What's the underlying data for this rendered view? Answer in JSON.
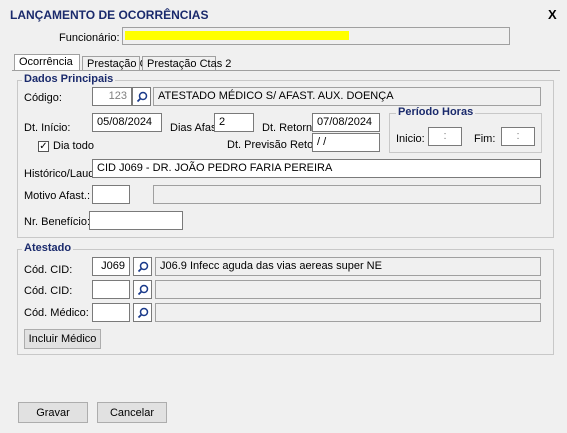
{
  "window": {
    "title": "LANÇAMENTO DE OCORRÊNCIAS",
    "close": "X"
  },
  "header": {
    "funcionario_label": "Funcionário:",
    "funcionario_value": ""
  },
  "tabs": [
    {
      "label": "Ocorrência"
    },
    {
      "label": "Prestação Ctas"
    },
    {
      "label": "Prestação Ctas 2"
    }
  ],
  "dados": {
    "group_label": "Dados Principais",
    "codigo_label": "Código:",
    "codigo_value": "123",
    "codigo_desc": "ATESTADO MÉDICO S/ AFAST. AUX. DOENÇA",
    "dt_inicio_label": "Dt. Início:",
    "dt_inicio_value": "05/08/2024",
    "dias_afast_label": "Dias Afast.",
    "dias_afast_value": "2",
    "dt_retorno_label": "Dt. Retorno:",
    "dt_retorno_value": "07/08/2024",
    "dt_prev_label": "Dt. Previsão Retorno:",
    "dt_prev_value": " / /",
    "dia_todo_label": "Dia todo",
    "dia_todo_checked": true,
    "periodo_label": "Período Horas",
    "inicio_label": "Inicio:",
    "inicio_value": ":",
    "fim_label": "Fim:",
    "fim_value": ":",
    "historico_label": "Histórico/Laudo:",
    "historico_value": "CID J069 - DR. JOÃO PEDRO FARIA PEREIRA",
    "motivo_label": "Motivo Afast.:",
    "motivo_value": "",
    "motivo_desc": "",
    "beneficio_label": "Nr. Benefício:",
    "beneficio_value": ""
  },
  "atestado": {
    "group_label": "Atestado",
    "cid1_label": "Cód. CID:",
    "cid1_value": "J069",
    "cid1_desc": "J06.9 Infecc aguda das vias aereas super NE",
    "cid2_label": "Cód. CID:",
    "cid2_value": "",
    "cid2_desc": "",
    "medico_label": "Cód. Médico:",
    "medico_value": "",
    "medico_desc": "",
    "incluir_medico": "Incluir Médico"
  },
  "footer": {
    "gravar": "Gravar",
    "cancelar": "Cancelar"
  },
  "colors": {
    "title": "#1a2a6c",
    "highlight": "#ffff00",
    "background": "#f0f0f0"
  }
}
